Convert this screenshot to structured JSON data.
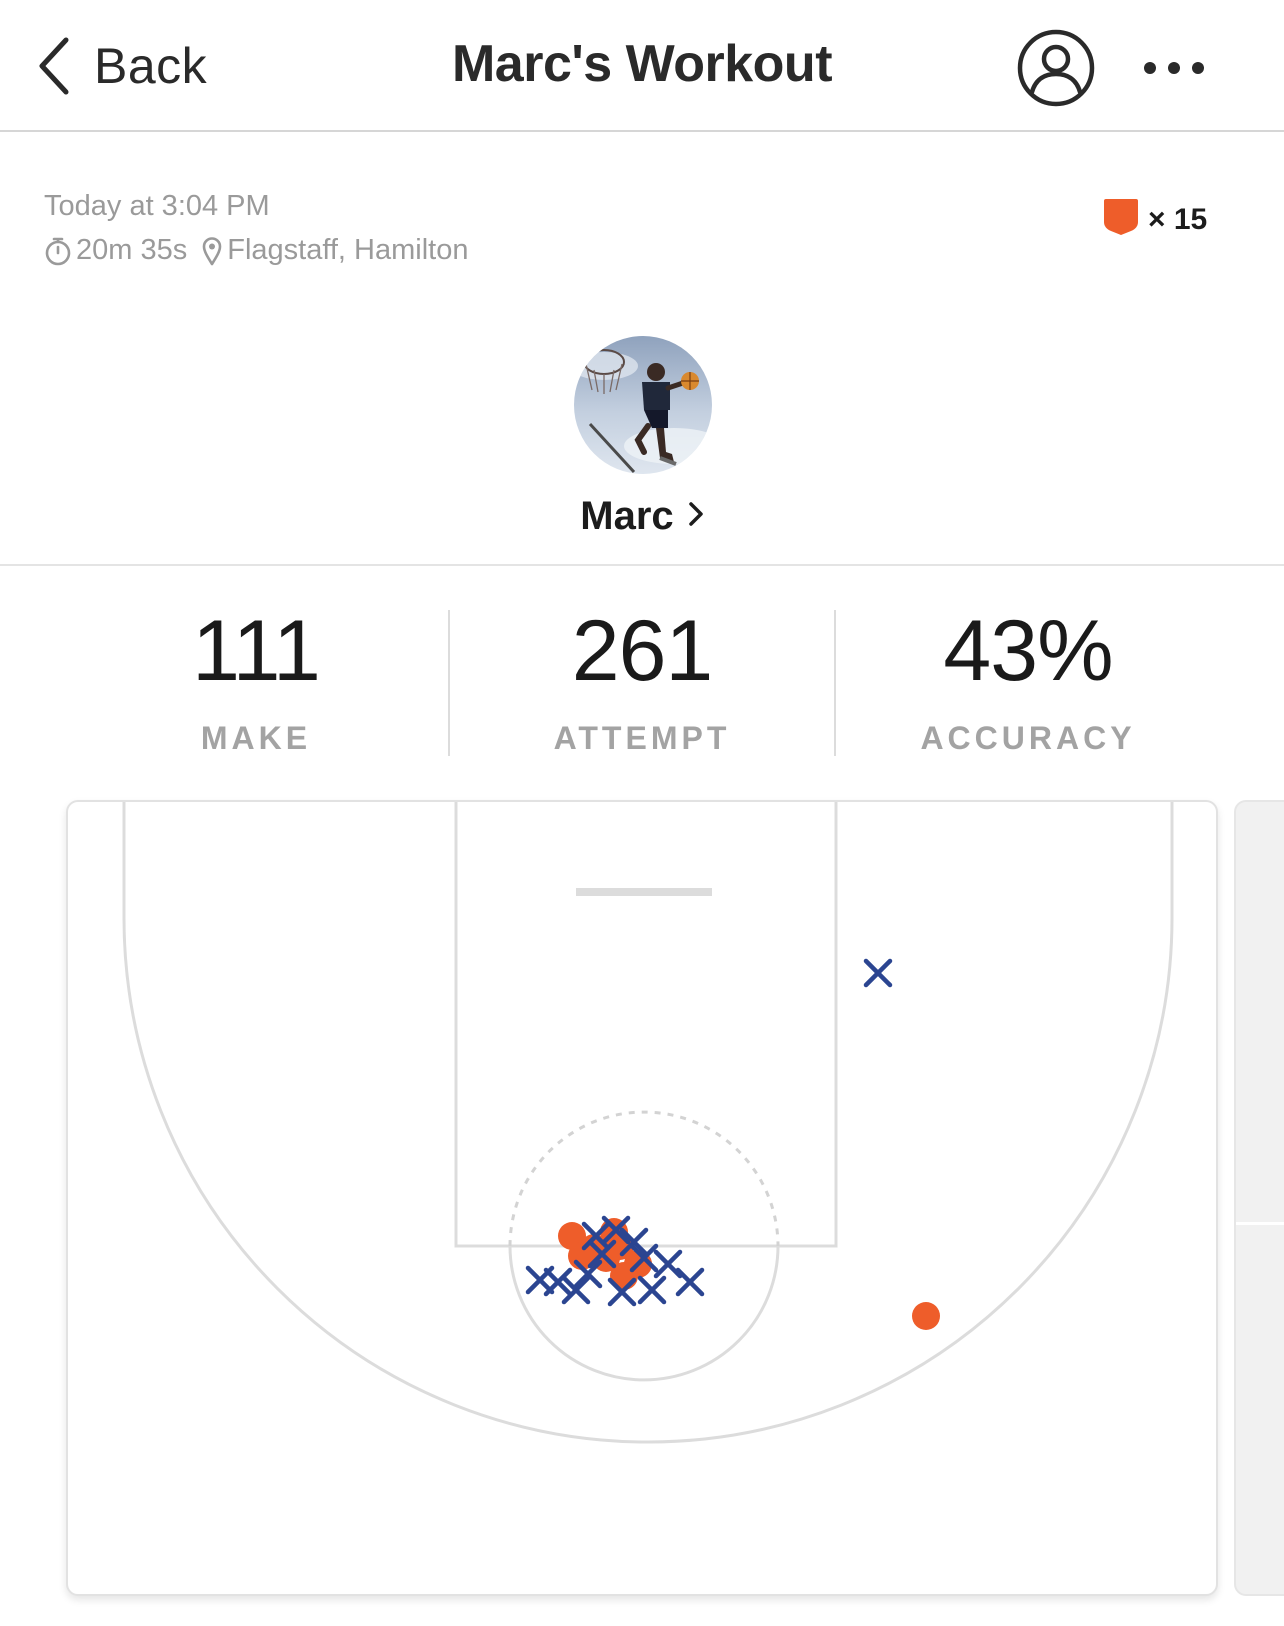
{
  "nav": {
    "back_label": "Back",
    "title": "Marc's Workout"
  },
  "meta": {
    "time": "Today at 3:04 PM",
    "duration": "20m 35s",
    "location": "Flagstaff, Hamilton",
    "badge_count": "× 15"
  },
  "player": {
    "name": "Marc"
  },
  "stats": [
    {
      "value": "111",
      "label": "MAKE"
    },
    {
      "value": "261",
      "label": "ATTEMPT"
    },
    {
      "value": "43%",
      "label": "ACCURACY"
    }
  ],
  "colors": {
    "make": "#ee5d2a",
    "miss": "#2b4591",
    "court_line": "#dcdcdc",
    "badge": "#ee5d2a"
  },
  "icons": {
    "back": "chevron-left-icon",
    "profile": "user-circle-icon",
    "more": "ellipsis-icon",
    "timer": "stopwatch-icon",
    "location": "map-pin-icon",
    "badge": "shield-badge-icon",
    "player_link": "chevron-right-icon"
  }
}
